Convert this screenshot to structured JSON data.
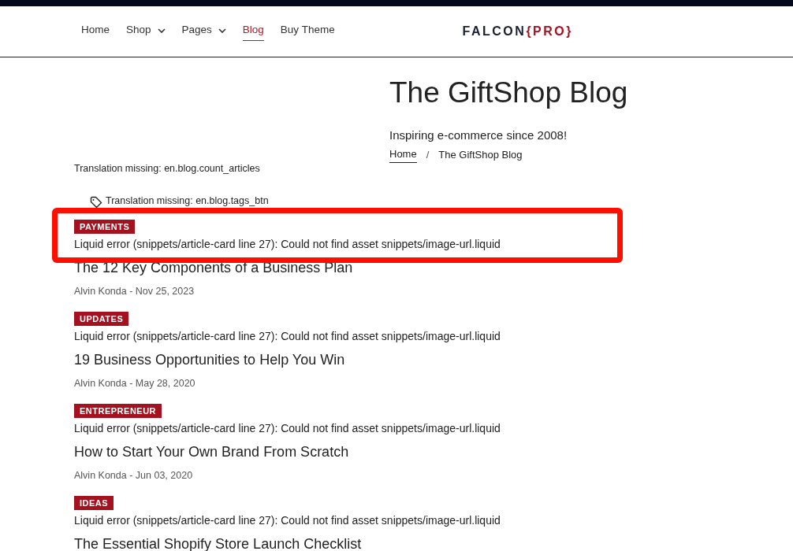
{
  "nav": {
    "items": [
      {
        "label": "Home",
        "dropdown": false,
        "selected": false
      },
      {
        "label": "Shop",
        "dropdown": true,
        "selected": false
      },
      {
        "label": "Pages",
        "dropdown": true,
        "selected": false
      },
      {
        "label": "Blog",
        "dropdown": false,
        "selected": true
      },
      {
        "label": "Buy Theme",
        "dropdown": false,
        "selected": false
      }
    ],
    "logo": {
      "main": "FALCON",
      "accent": "{PRO}"
    }
  },
  "hero": {
    "title": "The GiftShop Blog",
    "subtitle": "Inspiring e-commerce since 2008!",
    "breadcrumb": [
      {
        "label": "Home",
        "link": true
      },
      {
        "label": "The GiftShop Blog",
        "link": false
      }
    ],
    "separator": "/"
  },
  "count_text": "Translation missing: en.blog.count_articles",
  "tags_button": "Translation missing: en.blog.tags_btn",
  "articles": [
    {
      "category": "PAYMENTS",
      "error": "Liquid error (snippets/article-card line 27): Could not find asset snippets/image-url.liquid",
      "title": "The 12 Key Components of a Business Plan",
      "meta": "Alvin Konda - Nov 25, 2023",
      "highlighted": true
    },
    {
      "category": "UPDATES",
      "error": "Liquid error (snippets/article-card line 27): Could not find asset snippets/image-url.liquid",
      "title": "19 Business Opportunities to Help You Win",
      "meta": "Alvin Konda - May 28, 2020",
      "highlighted": false
    },
    {
      "category": "ENTREPRENEUR",
      "error": "Liquid error (snippets/article-card line 27): Could not find asset snippets/image-url.liquid",
      "title": "How to Start Your Own Brand From Scratch",
      "meta": "Alvin Konda - Jun 03, 2020",
      "highlighted": false
    },
    {
      "category": "IDEAS",
      "error": "Liquid error (snippets/article-card line 27): Could not find asset snippets/image-url.liquid",
      "title": "The Essential Shopify Store Launch Checklist",
      "highlighted": false
    }
  ]
}
